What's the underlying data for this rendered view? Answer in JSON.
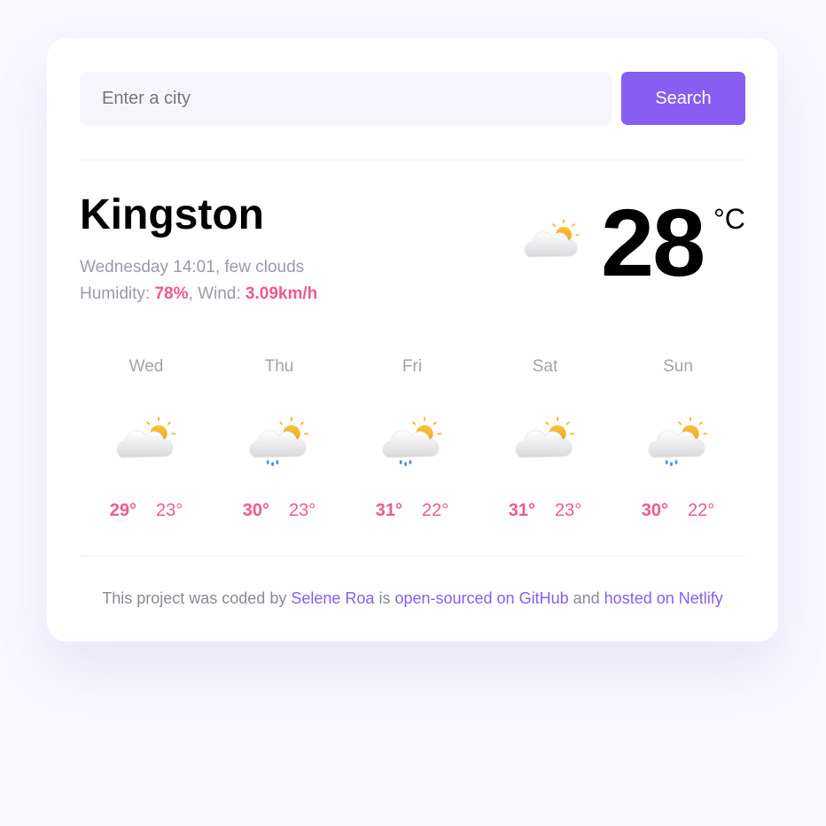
{
  "search": {
    "placeholder": "Enter a city",
    "value": "",
    "button_label": "Search"
  },
  "current": {
    "city": "Kingston",
    "day_time": "Wednesday 14:01",
    "description": "few clouds",
    "humidity_label": "Humidity:",
    "humidity": "78%",
    "wind_label": "Wind:",
    "wind": "3.09km/h",
    "temperature": "28",
    "unit": "°C",
    "icon": "few-clouds-icon"
  },
  "forecast": [
    {
      "day": "Wed",
      "max": "29°",
      "min": "23°",
      "icon": "few-clouds-icon"
    },
    {
      "day": "Thu",
      "max": "30°",
      "min": "23°",
      "icon": "rain-cloud-sun-icon"
    },
    {
      "day": "Fri",
      "max": "31°",
      "min": "22°",
      "icon": "rain-cloud-sun-icon"
    },
    {
      "day": "Sat",
      "max": "31°",
      "min": "23°",
      "icon": "few-clouds-icon"
    },
    {
      "day": "Sun",
      "max": "30°",
      "min": "22°",
      "icon": "rain-cloud-sun-icon"
    }
  ],
  "footer": {
    "prefix": "This project was coded by",
    "author_link": "Selene Roa",
    "mid": "is",
    "github_link": "open-sourced on GitHub",
    "and": "and",
    "netlify_link": "hosted on Netlify"
  },
  "colors": {
    "accent": "#885df1",
    "highlight": "#ef5a8a",
    "background": "#f8f7fd"
  }
}
